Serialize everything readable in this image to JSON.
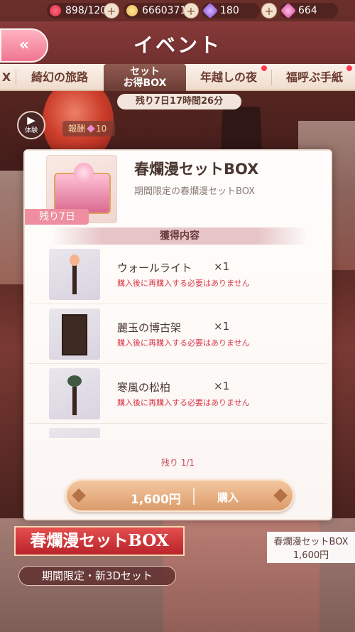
{
  "resources": [
    {
      "icon": "heart-icon",
      "value": "898/120"
    },
    {
      "icon": "cat-coin-icon",
      "value": "6660371"
    },
    {
      "icon": "diamond-icon",
      "value": "180"
    },
    {
      "icon": "pink-diamond-icon",
      "value": "664"
    }
  ],
  "header": {
    "back": "«",
    "title": "イベント"
  },
  "tabs": [
    {
      "label": "X"
    },
    {
      "label": "綺幻の旅路"
    },
    {
      "label_line1": "セット",
      "label_line2": "お得BOX",
      "selected": true
    },
    {
      "label": "年越しの夜"
    },
    {
      "label": "福呼ぶ手紙"
    }
  ],
  "timer": "残り7日17時間26分",
  "trial": {
    "label": "体験"
  },
  "reward": {
    "label": "報酬",
    "value": "10"
  },
  "modal": {
    "title": "春爛漫セットBOX",
    "subtitle": "期間限定の春爛漫セットBOX",
    "remaining_tag": "残り7日",
    "section": "獲得内容",
    "items": [
      {
        "name": "ウォールライト",
        "qty": "×1",
        "note": "購入後に再購入する必要はありません"
      },
      {
        "name": "麗玉の博古架",
        "qty": "×1",
        "note": "購入後に再購入する必要はありません"
      },
      {
        "name": "寒風の松柏",
        "qty": "×1",
        "note": "購入後に再購入する必要はありません"
      }
    ],
    "stock": "残り 1/1",
    "price": "1,600円",
    "buy": "購入"
  },
  "banner": {
    "title": "春爛漫セットBOX",
    "subtitle": "期間限定・新3Dセット"
  },
  "side_card": {
    "title": "春爛漫セットBOX",
    "price": "1,600円"
  }
}
